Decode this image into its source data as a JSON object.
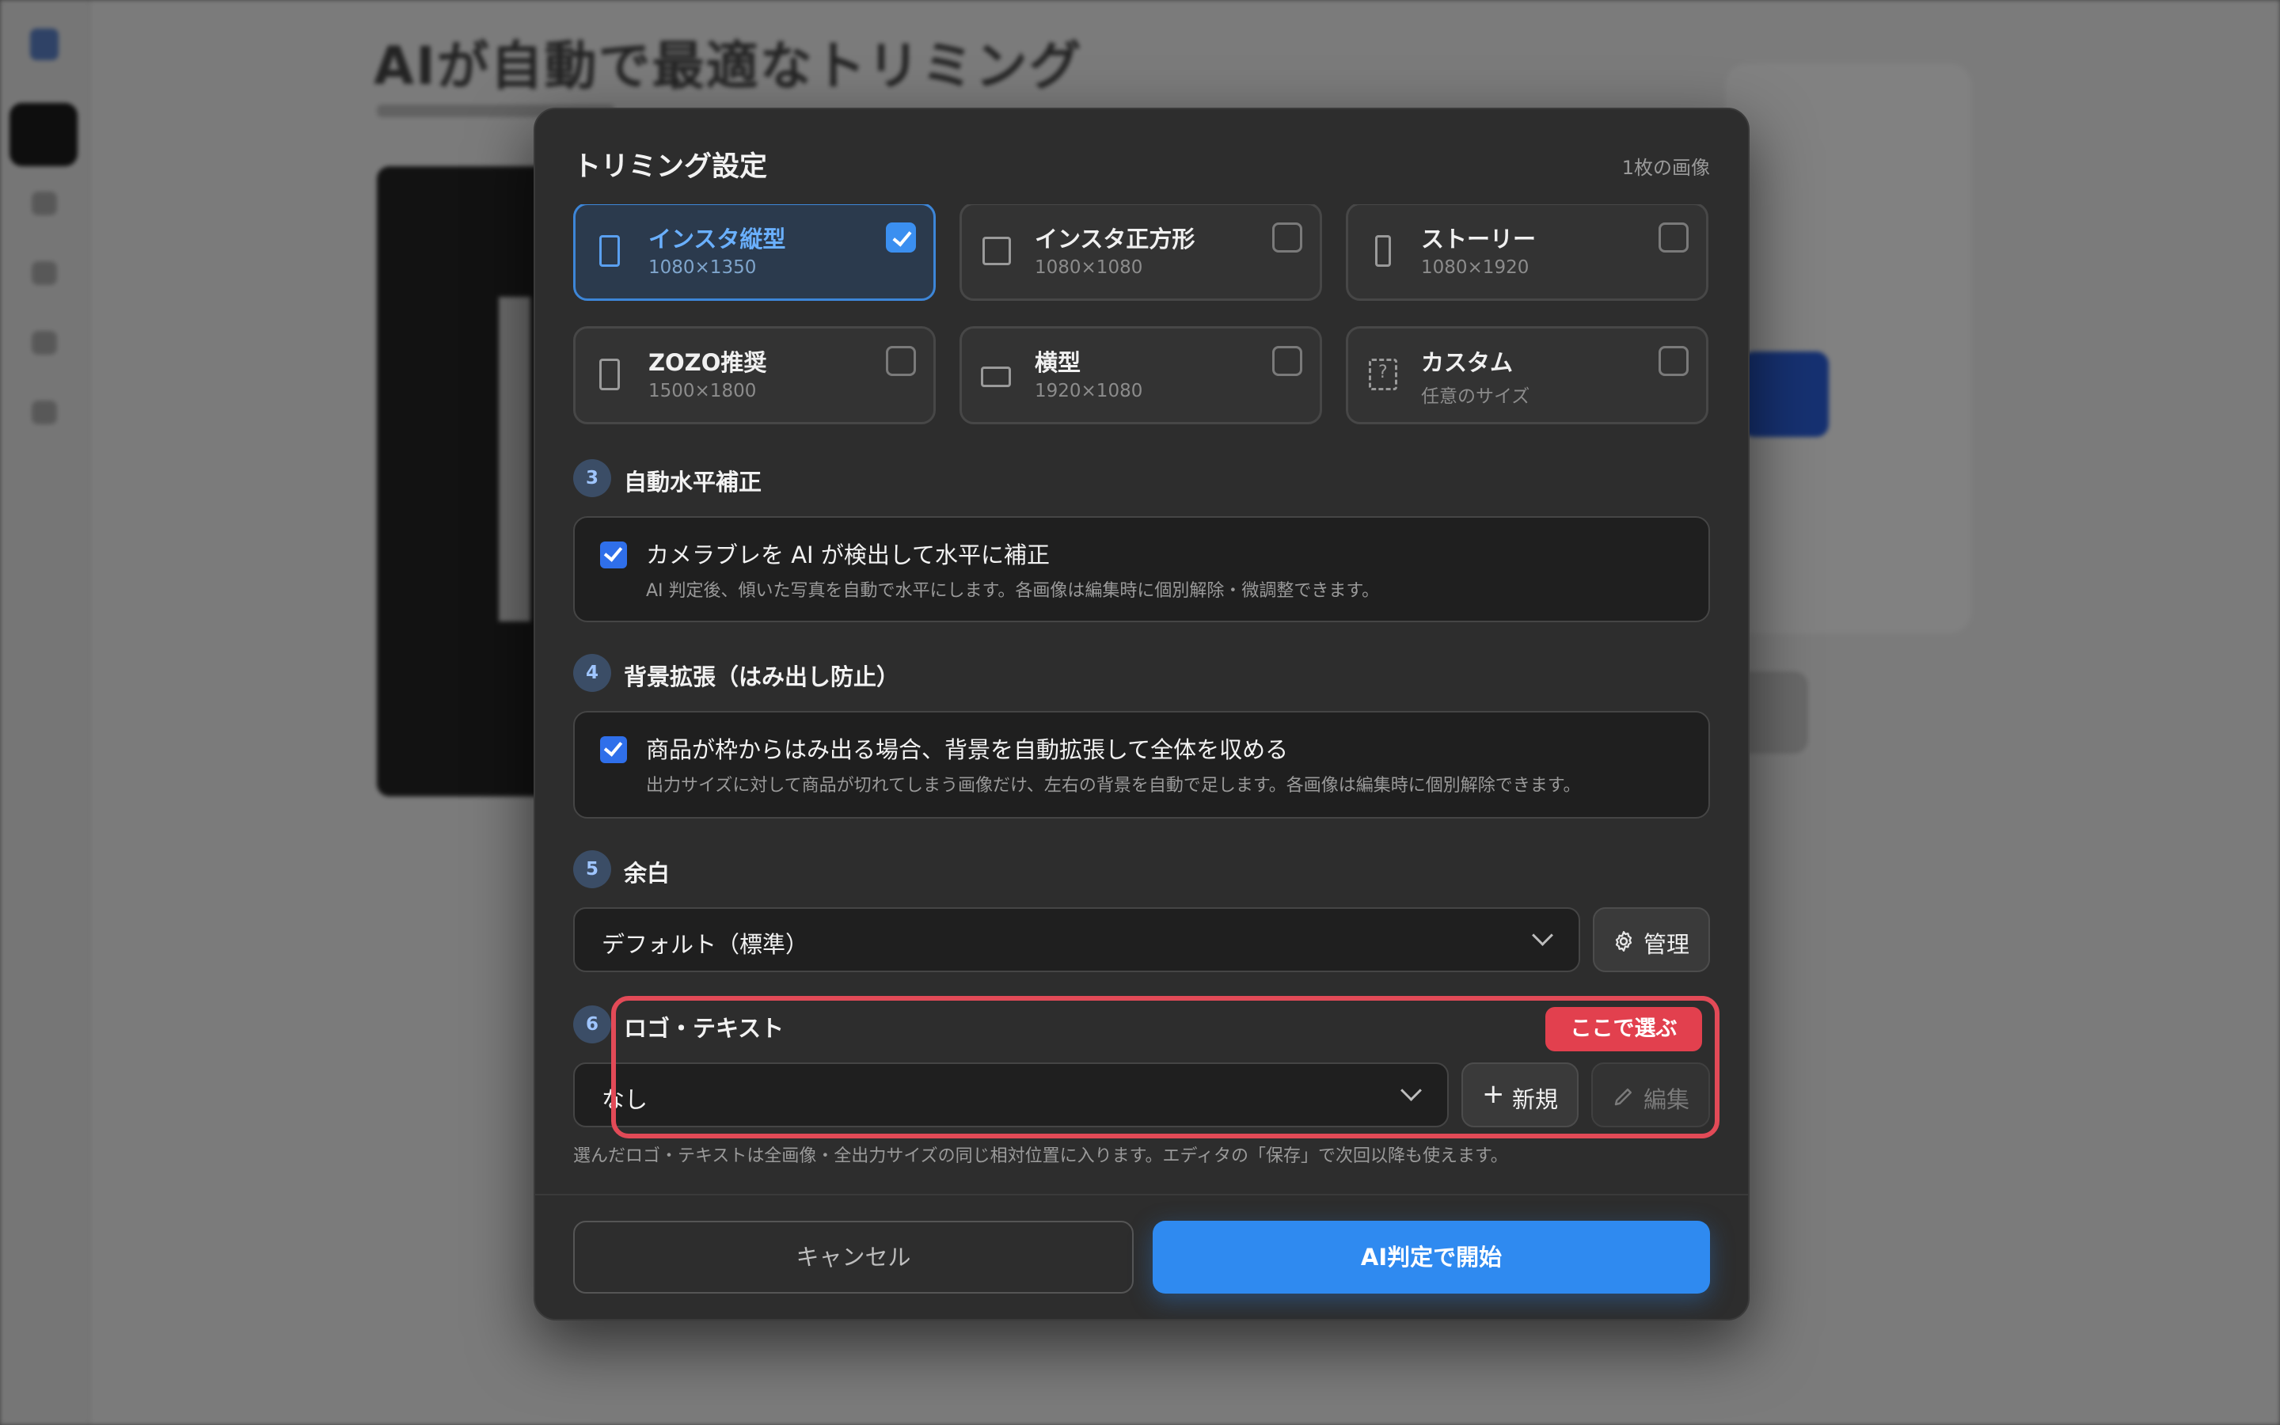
{
  "background": {
    "page_title": "AIが自動で最適なトリミング"
  },
  "modal": {
    "title": "トリミング設定",
    "image_count": "1枚の画像",
    "size_options": [
      {
        "name": "インスタ縦型",
        "size": "1080×1350",
        "selected": true,
        "icon": "portrait-frame-icon"
      },
      {
        "name": "インスタ正方形",
        "size": "1080×1080",
        "selected": false,
        "icon": "square-frame-icon"
      },
      {
        "name": "ストーリー",
        "size": "1080×1920",
        "selected": false,
        "icon": "story-frame-icon"
      },
      {
        "name": "ZOZO推奨",
        "size": "1500×1800",
        "selected": false,
        "icon": "portrait-frame-icon"
      },
      {
        "name": "横型",
        "size": "1920×1080",
        "selected": false,
        "icon": "landscape-frame-icon"
      },
      {
        "name": "カスタム",
        "size": "任意のサイズ",
        "selected": false,
        "icon": "custom-frame-icon"
      }
    ],
    "sections": {
      "auto_level": {
        "number": "3",
        "title": "自動水平補正",
        "checked": true,
        "label": "カメラブレを AI が検出して水平に補正",
        "description": "AI 判定後、傾いた写真を自動で水平にします。各画像は編集時に個別解除・微調整できます。"
      },
      "bg_extend": {
        "number": "4",
        "title": "背景拡張（はみ出し防止）",
        "checked": true,
        "label": "商品が枠からはみ出る場合、背景を自動拡張して全体を収める",
        "description": "出力サイズに対して商品が切れてしまう画像だけ、左右の背景を自動で足します。各画像は編集時に個別解除できます。"
      },
      "margin": {
        "number": "5",
        "title": "余白",
        "selected_value": "デフォルト（標準）",
        "manage_label": "管理"
      },
      "logo_text": {
        "number": "6",
        "title": "ロゴ・テキスト",
        "selected_value": "なし",
        "new_label": "新規",
        "edit_label": "編集",
        "callout": "ここで選ぶ",
        "note": "選んだロゴ・テキストは全画像・全出力サイズの同じ相対位置に入ります。エディタの「保存」で次回以降も使えます。"
      }
    },
    "footer": {
      "cancel_label": "キャンセル",
      "start_label": "AI判定で開始"
    }
  },
  "colors": {
    "accent": "#2f8af0",
    "highlight": "#e24a57",
    "modal_bg": "#2d2d2d"
  }
}
